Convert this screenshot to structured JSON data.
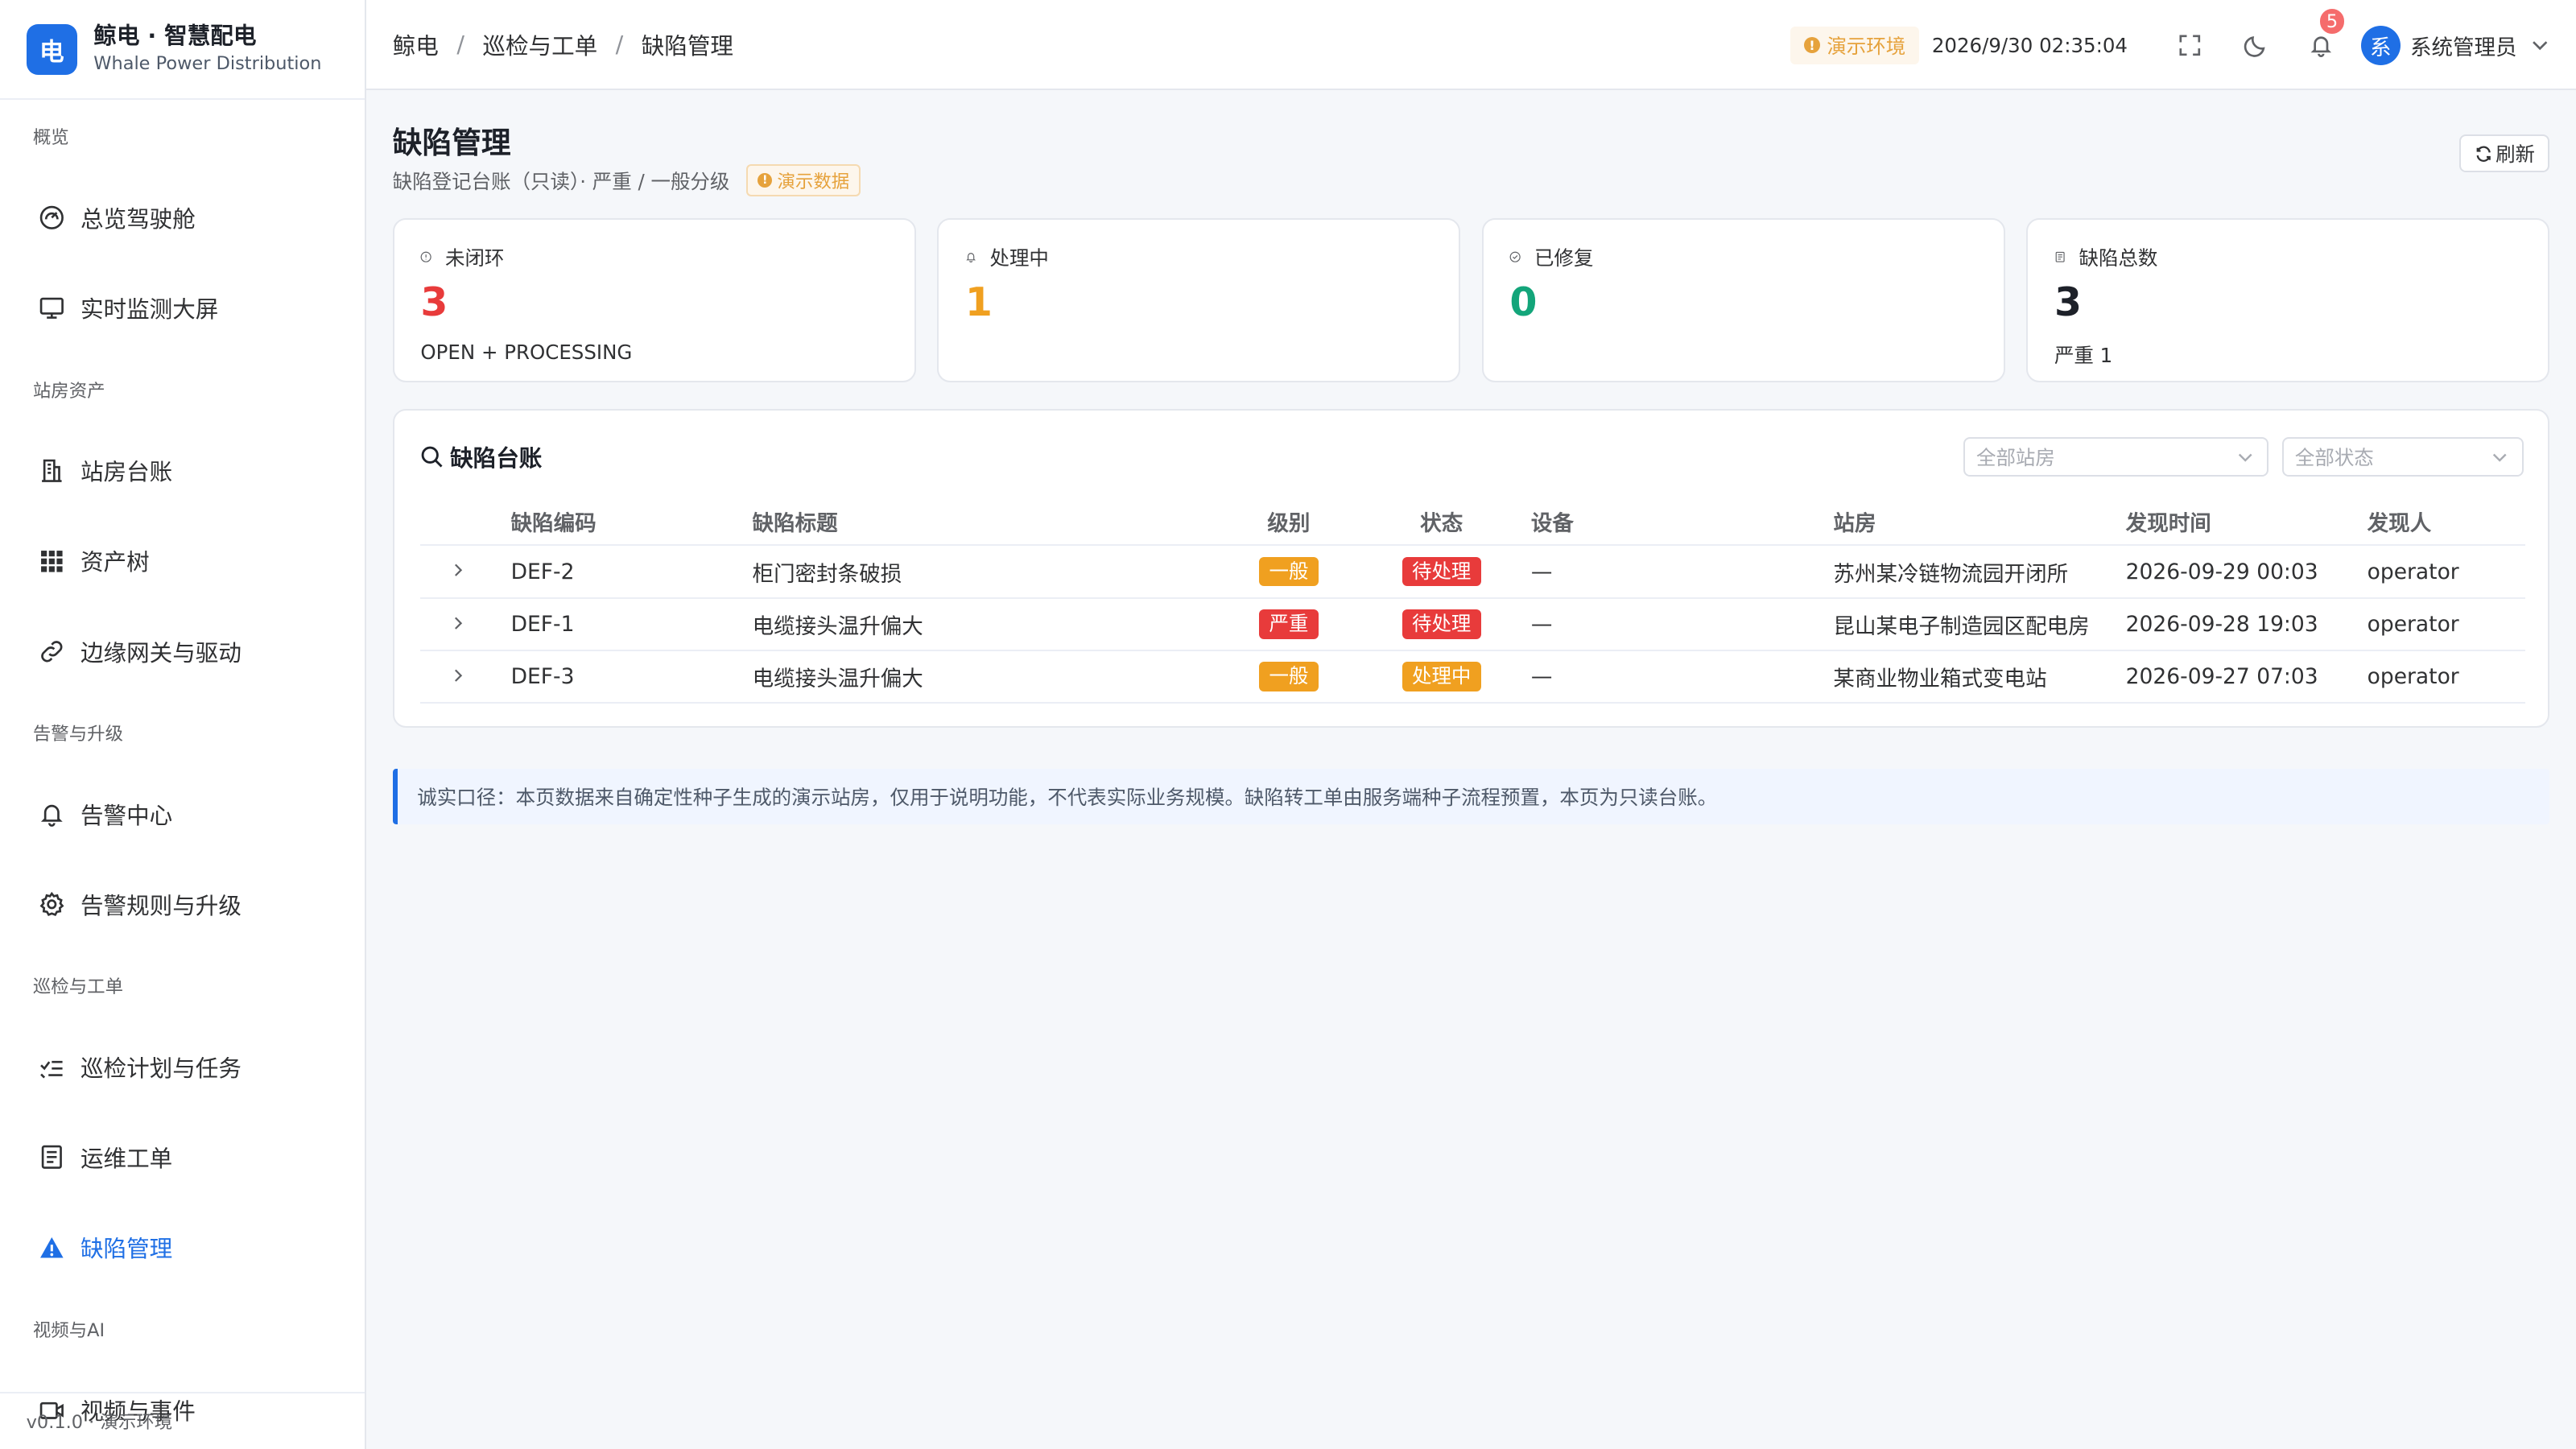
{
  "brand": {
    "logo": "电",
    "title": "鲸电 · 智慧配电",
    "subtitle": "Whale Power Distribution"
  },
  "sidebar": {
    "groups": [
      {
        "label": "概览",
        "items": [
          {
            "label": "总览驾驶舱",
            "icon": "dashboard-icon"
          },
          {
            "label": "实时监测大屏",
            "icon": "monitor-icon"
          }
        ]
      },
      {
        "label": "站房资产",
        "items": [
          {
            "label": "站房台账",
            "icon": "building-icon"
          },
          {
            "label": "资产树",
            "icon": "grid-icon"
          },
          {
            "label": "边缘网关与驱动",
            "icon": "link-icon"
          }
        ]
      },
      {
        "label": "告警与升级",
        "items": [
          {
            "label": "告警中心",
            "icon": "bell-icon"
          },
          {
            "label": "告警规则与升级",
            "icon": "gear-icon"
          }
        ]
      },
      {
        "label": "巡检与工单",
        "items": [
          {
            "label": "巡检计划与任务",
            "icon": "checklist-icon"
          },
          {
            "label": "运维工单",
            "icon": "document-icon"
          },
          {
            "label": "缺陷管理",
            "icon": "warning-icon",
            "active": true
          }
        ]
      },
      {
        "label": "视频与AI",
        "items": [
          {
            "label": "视频与事件",
            "icon": "video-icon"
          }
        ]
      }
    ],
    "footer": "v0.1.0 · 演示环境"
  },
  "header": {
    "breadcrumb": [
      "鲸电",
      "巡检与工单",
      "缺陷管理"
    ],
    "env_tag": "演示环境",
    "clock": "2026/9/30 02:35:04",
    "notification_count": "5",
    "avatar": "系",
    "user": "系统管理员"
  },
  "page": {
    "title": "缺陷管理",
    "subtitle": "缺陷登记台账（只读）· 严重 / 一般分级",
    "demo_tag": "演示数据",
    "refresh_label": "刷新"
  },
  "stats": [
    {
      "label": "未闭环",
      "value": "3",
      "sub": "OPEN + PROCESSING",
      "color": "#e83b3b",
      "icon": "info-circle-icon"
    },
    {
      "label": "处理中",
      "value": "1",
      "sub": "",
      "color": "#f0a020",
      "icon": "bell-icon"
    },
    {
      "label": "已修复",
      "value": "0",
      "sub": "",
      "color": "#13a57a",
      "icon": "check-circle-icon"
    },
    {
      "label": "缺陷总数",
      "value": "3",
      "sub": "严重 1",
      "color": "#1d2129",
      "icon": "document-icon"
    }
  ],
  "ledger": {
    "title": "缺陷台账",
    "station_filter_placeholder": "全部站房",
    "status_filter_placeholder": "全部状态",
    "columns": [
      "缺陷编码",
      "缺陷标题",
      "级别",
      "状态",
      "设备",
      "站房",
      "发现时间",
      "发现人"
    ],
    "rows": [
      {
        "code": "DEF-2",
        "title": "柜门密封条破损",
        "level": "一般",
        "level_color": "orange",
        "status": "待处理",
        "status_color": "red",
        "device": "—",
        "station": "苏州某冷链物流园开闭所",
        "time": "2026-09-29 00:03",
        "finder": "operator"
      },
      {
        "code": "DEF-1",
        "title": "电缆接头温升偏大",
        "level": "严重",
        "level_color": "red",
        "status": "待处理",
        "status_color": "red",
        "device": "—",
        "station": "昆山某电子制造园区配电房",
        "time": "2026-09-28 19:03",
        "finder": "operator"
      },
      {
        "code": "DEF-3",
        "title": "电缆接头温升偏大",
        "level": "一般",
        "level_color": "orange",
        "status": "处理中",
        "status_color": "orange",
        "device": "—",
        "station": "某商业物业箱式变电站",
        "time": "2026-09-27 07:03",
        "finder": "operator"
      }
    ]
  },
  "note": "诚实口径：本页数据来自确定性种子生成的演示站房，仅用于说明功能，不代表实际业务规模。缺陷转工单由服务端种子流程预置，本页为只读台账。"
}
